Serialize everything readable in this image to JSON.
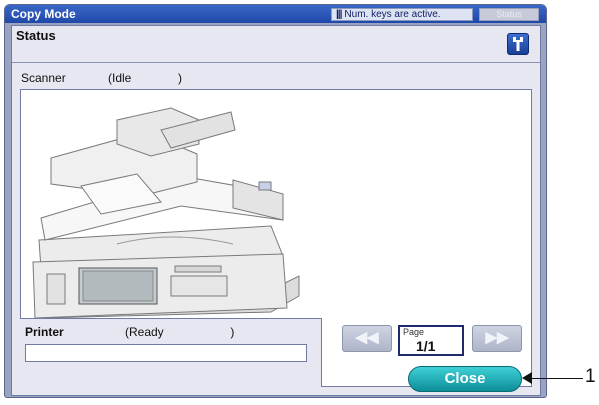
{
  "window": {
    "title": "Copy Mode"
  },
  "header": {
    "num_keys_notice": "Num. keys are active.",
    "status_button": "Status"
  },
  "panel": {
    "title": "Status",
    "tool_icon": "wrench-icon"
  },
  "scanner": {
    "label": "Scanner",
    "state": "(Idle              )"
  },
  "printer": {
    "label": "Printer",
    "state": "(Ready                    )",
    "message": ""
  },
  "pager": {
    "caption": "Page",
    "value": "1/1",
    "prev_icon": "rewind-icon",
    "next_icon": "fast-forward-icon"
  },
  "footer": {
    "close_label": "Close"
  },
  "callout": {
    "number": "1"
  },
  "colors": {
    "title_bar": "#1f49a8",
    "close_button": "#1aa9b1",
    "panel_bg": "#e6e7f0"
  }
}
